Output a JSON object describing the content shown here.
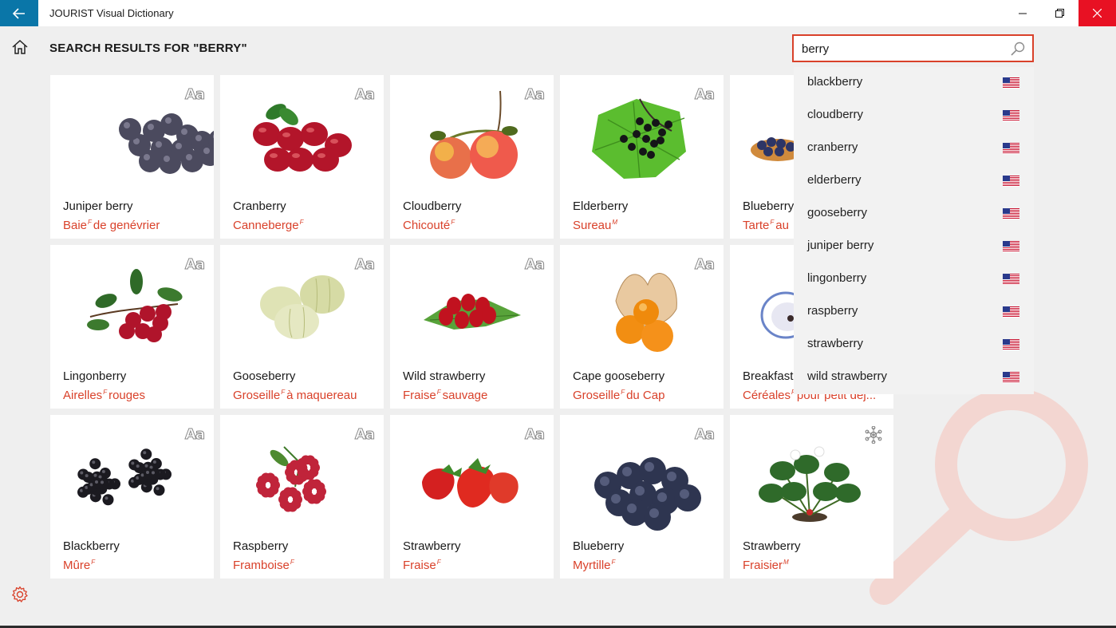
{
  "app": {
    "title": "JOURIST Visual Dictionary"
  },
  "page": {
    "heading": "SEARCH RESULTS FOR \"BERRY\""
  },
  "search": {
    "value": "berry"
  },
  "colors": {
    "accent": "#d9412a",
    "back_button": "#0a76a8",
    "close_button": "#e81123"
  },
  "suggestions": [
    {
      "label": "blackberry",
      "flag": "us-flag-icon"
    },
    {
      "label": "cloudberry",
      "flag": "us-flag-icon"
    },
    {
      "label": "cranberry",
      "flag": "us-flag-icon"
    },
    {
      "label": "elderberry",
      "flag": "us-flag-icon"
    },
    {
      "label": "gooseberry",
      "flag": "us-flag-icon"
    },
    {
      "label": "juniper berry",
      "flag": "us-flag-icon"
    },
    {
      "label": "lingonberry",
      "flag": "us-flag-icon"
    },
    {
      "label": "raspberry",
      "flag": "us-flag-icon"
    },
    {
      "label": "strawberry",
      "flag": "us-flag-icon"
    },
    {
      "label": "wild strawberry",
      "flag": "us-flag-icon"
    }
  ],
  "cards": [
    {
      "en": "Juniper berry",
      "fr": "Baie",
      "g": "F",
      "fr2": "de genévrier",
      "icon": "aa-icon"
    },
    {
      "en": "Cranberry",
      "fr": "Canneberge",
      "g": "F",
      "fr2": "",
      "icon": "aa-icon"
    },
    {
      "en": "Cloudberry",
      "fr": "Chicouté",
      "g": "F",
      "fr2": "",
      "icon": "aa-icon"
    },
    {
      "en": "Elderberry",
      "fr": "Sureau",
      "g": "M",
      "fr2": "",
      "icon": "aa-icon"
    },
    {
      "en": "Blueberry",
      "fr": "Tarte",
      "g": "F",
      "fr2": "au",
      "icon": "aa-icon"
    },
    {
      "en": "Lingonberry",
      "fr": "Airelles",
      "g": "F",
      "fr2": "rouges",
      "icon": "aa-icon"
    },
    {
      "en": "Gooseberry",
      "fr": "Groseille",
      "g": "F",
      "fr2": "à maquereau",
      "icon": "aa-icon"
    },
    {
      "en": "Wild strawberry",
      "fr": "Fraise",
      "g": "F",
      "fr2": "sauvage",
      "icon": "aa-icon"
    },
    {
      "en": "Cape gooseberry",
      "fr": "Groseille",
      "g": "F",
      "fr2": "du Cap",
      "icon": "aa-icon"
    },
    {
      "en": "Breakfast",
      "fr": "Céréales",
      "g": "F",
      "fr2": "pour petit déj...",
      "icon": "aa-icon"
    },
    {
      "en": "Blackberry",
      "fr": "Mûre",
      "g": "F",
      "fr2": "",
      "icon": "aa-icon"
    },
    {
      "en": "Raspberry",
      "fr": "Framboise",
      "g": "F",
      "fr2": "",
      "icon": "aa-icon"
    },
    {
      "en": "Strawberry",
      "fr": "Fraise",
      "g": "F",
      "fr2": "",
      "icon": "aa-icon"
    },
    {
      "en": "Blueberry",
      "fr": "Myrtille",
      "g": "F",
      "fr2": "",
      "icon": "aa-icon"
    },
    {
      "en": "Strawberry",
      "fr": "Fraisier",
      "g": "M",
      "fr2": "",
      "icon": "network-icon"
    }
  ]
}
